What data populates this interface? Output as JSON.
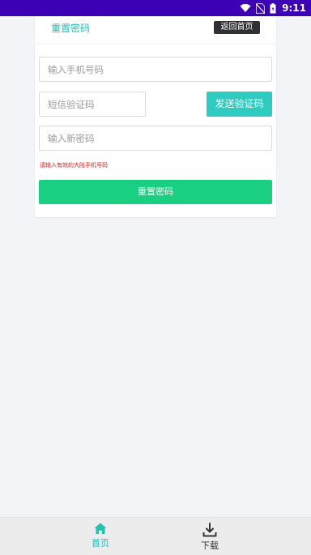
{
  "status_bar": {
    "time": "9:11",
    "icons": [
      "wifi-icon",
      "no-sim-icon",
      "battery-icon"
    ]
  },
  "card": {
    "title": "重置密码",
    "back_button": "返回首页",
    "phone_placeholder": "输入手机号码",
    "sms_placeholder": "短信验证码",
    "send_code_label": "发送验证码",
    "password_placeholder": "输入新密码",
    "error_message": "请输入有效的大陆手机号码",
    "submit_label": "重置密码"
  },
  "bottom_nav": {
    "items": [
      {
        "label": "首页",
        "icon": "home-icon",
        "active": true
      },
      {
        "label": "下载",
        "icon": "download-icon",
        "active": false
      }
    ]
  },
  "colors": {
    "status_bar": "#3c01b5",
    "accent": "#1fc1b3",
    "send_code": "#2dcbc0",
    "submit": "#19d082",
    "error": "#e2231a"
  }
}
